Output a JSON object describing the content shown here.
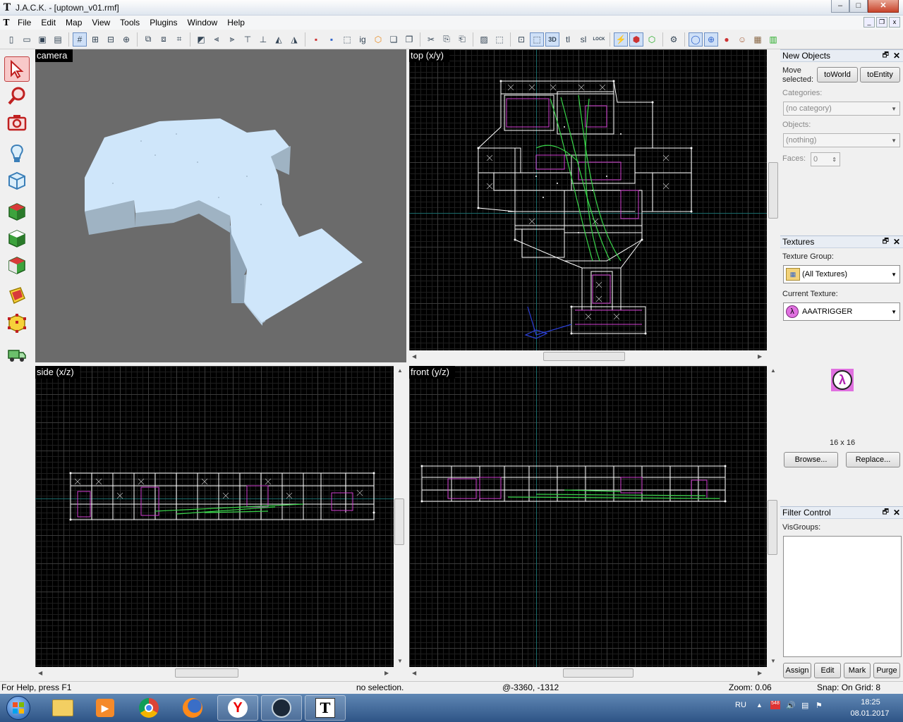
{
  "window": {
    "title": "J.A.C.K. - [uptown_v01.rmf]",
    "min": "‒",
    "max": "□",
    "close": "✕"
  },
  "menu": [
    "File",
    "Edit",
    "Map",
    "View",
    "Tools",
    "Plugins",
    "Window",
    "Help"
  ],
  "toolbar_icons": [
    "new-icon",
    "open-icon",
    "save-icon",
    "save-as-icon",
    "grid-icon",
    "3d-grid-icon",
    "smaller-grid-icon",
    "bigger-grid-icon",
    "group-icon",
    "ungroup-icon",
    "snap-icon",
    "carve-icon",
    "align-left-icon",
    "align-right-icon",
    "align-top-icon",
    "align-bottom-icon",
    "flip-h-icon",
    "flip-v-icon",
    "hide-icon",
    "show-icon",
    "select-icon",
    "ignore-group-icon",
    "cut-icon",
    "copy-icon",
    "paste-icon",
    "texture-lock-icon",
    "tie-to-entity-icon",
    "lock-icon"
  ],
  "toolbar_text": {
    "ig": "ig",
    "tl": "tl",
    "sl": "sl",
    "lock": "LOCK"
  },
  "views": {
    "camera": "camera",
    "top": "top (x/y)",
    "side": "side (x/z)",
    "front": "front (y/z)"
  },
  "new_objects": {
    "header": "New Objects",
    "move_selected": "Move",
    "move_selected2": "selected:",
    "to_world": "toWorld",
    "to_entity": "toEntity",
    "categories_label": "Categories:",
    "categories_value": "(no category)",
    "objects_label": "Objects:",
    "objects_value": "(nothing)",
    "faces_label": "Faces:",
    "faces_value": "0"
  },
  "textures": {
    "header": "Textures",
    "group_label": "Texture Group:",
    "group_value": "(All Textures)",
    "current_label": "Current Texture:",
    "current_value": "AAATRIGGER",
    "size": "16 x 16",
    "browse": "Browse...",
    "replace": "Replace..."
  },
  "filter": {
    "header": "Filter Control",
    "visgroups_label": "VisGroups:",
    "assign": "Assign",
    "edit": "Edit",
    "mark": "Mark",
    "purge": "Purge"
  },
  "status": {
    "help": "For Help, press F1",
    "selection": "no selection.",
    "coords": "@-3360, -1312",
    "zoom": "Zoom: 0.06",
    "snap": "Snap: On Grid: 8"
  },
  "taskbar": {
    "apps": [
      "start-button",
      "file-explorer-icon",
      "media-player-icon",
      "chrome-icon",
      "firefox-icon",
      "yandex-browser-icon",
      "steam-icon",
      "jack-editor-icon"
    ],
    "lang": "RU",
    "time": "18:25",
    "date": "08.01.2017"
  },
  "colors": {
    "selection_pink": "#f8c9c9",
    "brush_white": "#ffffff",
    "brush_magenta": "#d43fd4",
    "brush_green": "#39d64a",
    "camera_bg": "#6b6b6b",
    "brush_fill": "#cfe6fa"
  }
}
